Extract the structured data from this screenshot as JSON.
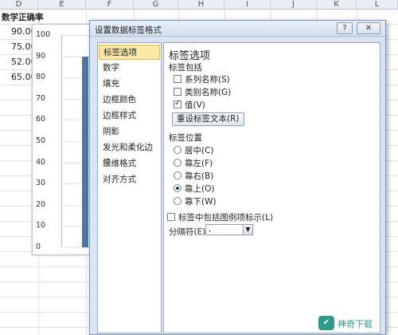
{
  "sheet": {
    "columns": [
      "D",
      "E",
      "F",
      "G",
      "H",
      "I",
      "J",
      "K",
      "L"
    ],
    "header_cell": "数学正确率",
    "values": [
      "90.00",
      "75.00",
      "52.00",
      "65.00"
    ]
  },
  "chart": {
    "y_ticks": [
      "100",
      "90",
      "80",
      "70",
      "60",
      "50",
      "40",
      "30",
      "20",
      "10",
      "0"
    ]
  },
  "chart_data": {
    "type": "bar",
    "categories": [
      ""
    ],
    "values": [
      90
    ],
    "ylim": [
      0,
      100
    ],
    "grid": true
  },
  "dialog": {
    "title": "设置数据标签格式",
    "help": "?",
    "close": "✕",
    "left_items": [
      "标签选项",
      "数字",
      "填充",
      "边框颜色",
      "边框样式",
      "阴影",
      "发光和柔化边缘",
      "三维格式",
      "对齐方式"
    ],
    "section_title": "标签选项",
    "label_contains": "标签包括",
    "checkboxes": [
      {
        "label": "系列名称(S)",
        "checked": false
      },
      {
        "label": "类别名称(G)",
        "checked": false
      },
      {
        "label": "值(V)",
        "checked": true
      }
    ],
    "reset_button": "重设标签文本(R)",
    "label_position": "标签位置",
    "radios": [
      {
        "label": "居中(C)",
        "checked": false
      },
      {
        "label": "靠左(F)",
        "checked": false
      },
      {
        "label": "靠右(B)",
        "checked": false
      },
      {
        "label": "靠上(O)",
        "checked": true
      },
      {
        "label": "靠下(W)",
        "checked": false
      }
    ],
    "legend_key_label": "标签中包括图例项标示(L)",
    "separator_label": "分隔符(E)",
    "separator_value": ","
  },
  "watermark": {
    "logo": "✔",
    "text": "神奇下载"
  }
}
